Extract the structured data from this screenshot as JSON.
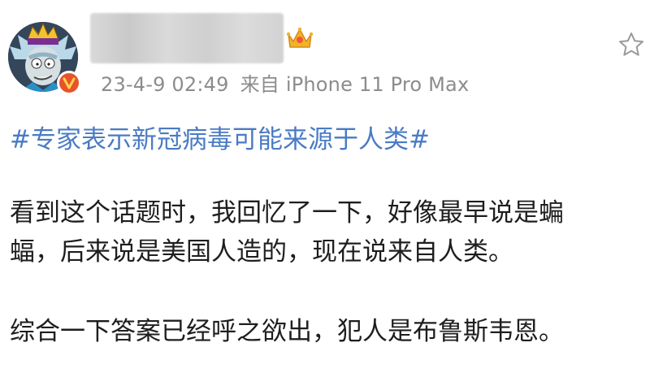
{
  "post": {
    "timestamp": "23-4-9 02:49",
    "source": "来自 iPhone 11 Pro Max",
    "topic": "#专家表示新冠病毒可能来源于人类#",
    "paragraph1_line1": "看到这个话题时，我回忆了一下，好像最早说是蝙",
    "paragraph1_line2": "蝠，后来说是美国人造的，现在说来自人类。",
    "paragraph2": "综合一下答案已经呼之欲出，犯人是布鲁斯韦恩。"
  },
  "icons": {
    "avatar": "avatar-rick-king-icon",
    "verified": "vip-v-badge-icon",
    "crown": "crown-icon",
    "favorite": "star-icon"
  },
  "colors": {
    "topic_link": "#4a7bc4",
    "meta_text": "#8c8c8c",
    "vip_badge": "#e8532b",
    "crown_gold": "#f0b429"
  }
}
